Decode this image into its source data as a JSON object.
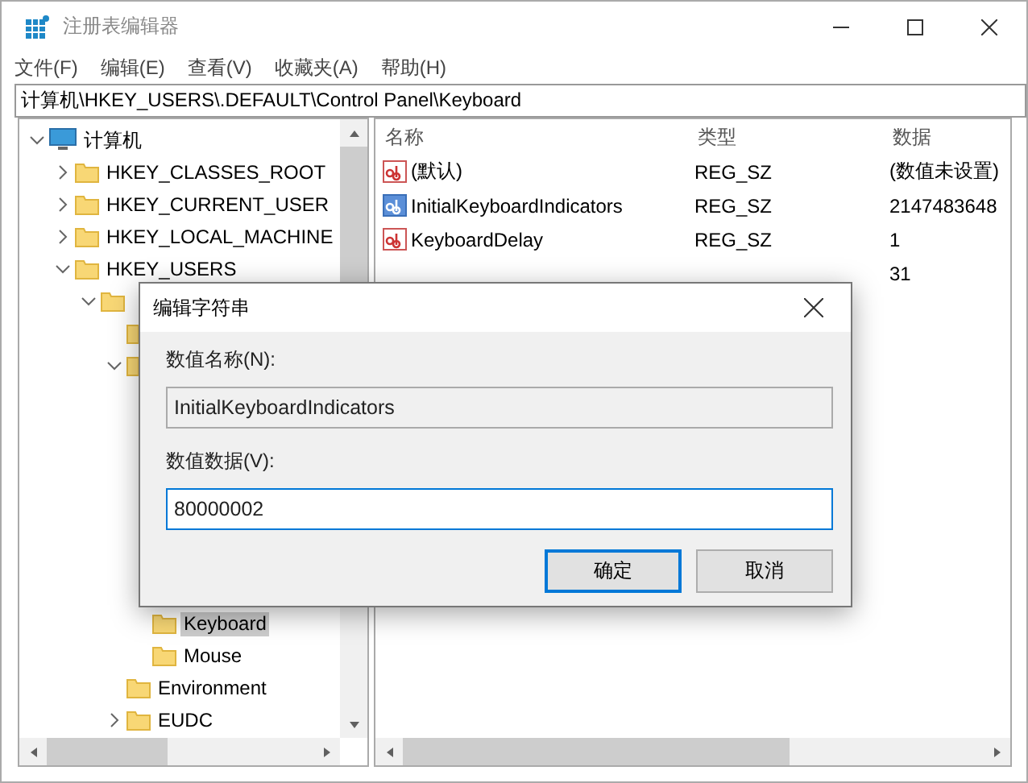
{
  "window": {
    "title": "注册表编辑器"
  },
  "menu": [
    "文件(F)",
    "编辑(E)",
    "查看(V)",
    "收藏夹(A)",
    "帮助(H)"
  ],
  "address": "计算机\\HKEY_USERS\\.DEFAULT\\Control Panel\\Keyboard",
  "tree": [
    {
      "label": "计算机",
      "kind": "computer",
      "expanded": true,
      "selected": false,
      "children": [
        {
          "label": "HKEY_CLASSES_ROOT",
          "expanded": false,
          "selected": false
        },
        {
          "label": "HKEY_CURRENT_USER",
          "expanded": false,
          "selected": false
        },
        {
          "label": "HKEY_LOCAL_MACHINE",
          "expanded": false,
          "selected": false
        },
        {
          "label": "HKEY_USERS",
          "expanded": true,
          "selected": false,
          "children": [
            {
              "expanded": true,
              "children": [
                {
                  "kind": "folder"
                },
                {
                  "kind": "folder",
                  "expanded": true,
                  "children": [
                    {
                      "label": "Keyboard",
                      "selected": true
                    },
                    {
                      "label": "Mouse",
                      "selected": false
                    }
                  ]
                },
                {
                  "label": "Environment",
                  "selected": false
                },
                {
                  "label": "EUDC",
                  "expanded": false,
                  "selected": false
                }
              ]
            }
          ]
        }
      ]
    }
  ],
  "list": {
    "columns": [
      "名称",
      "类型",
      "数据"
    ],
    "rows": [
      {
        "name": "(默认)",
        "type": "REG_SZ",
        "data": "(数值未设置)",
        "selected": false
      },
      {
        "name": "InitialKeyboardIndicators",
        "type": "REG_SZ",
        "data": "2147483648",
        "selected": true
      },
      {
        "name": "KeyboardDelay",
        "type": "REG_SZ",
        "data": "1",
        "selected": false
      },
      {
        "data": "31"
      }
    ]
  },
  "dialog": {
    "title": "编辑字符串",
    "name_label": "数值名称(N):",
    "name_value": "InitialKeyboardIndicators",
    "data_label": "数值数据(V):",
    "data_value": "80000002",
    "buttons": [
      {
        "label": "确定",
        "default": true
      },
      {
        "label": "取消",
        "default": false
      }
    ]
  }
}
